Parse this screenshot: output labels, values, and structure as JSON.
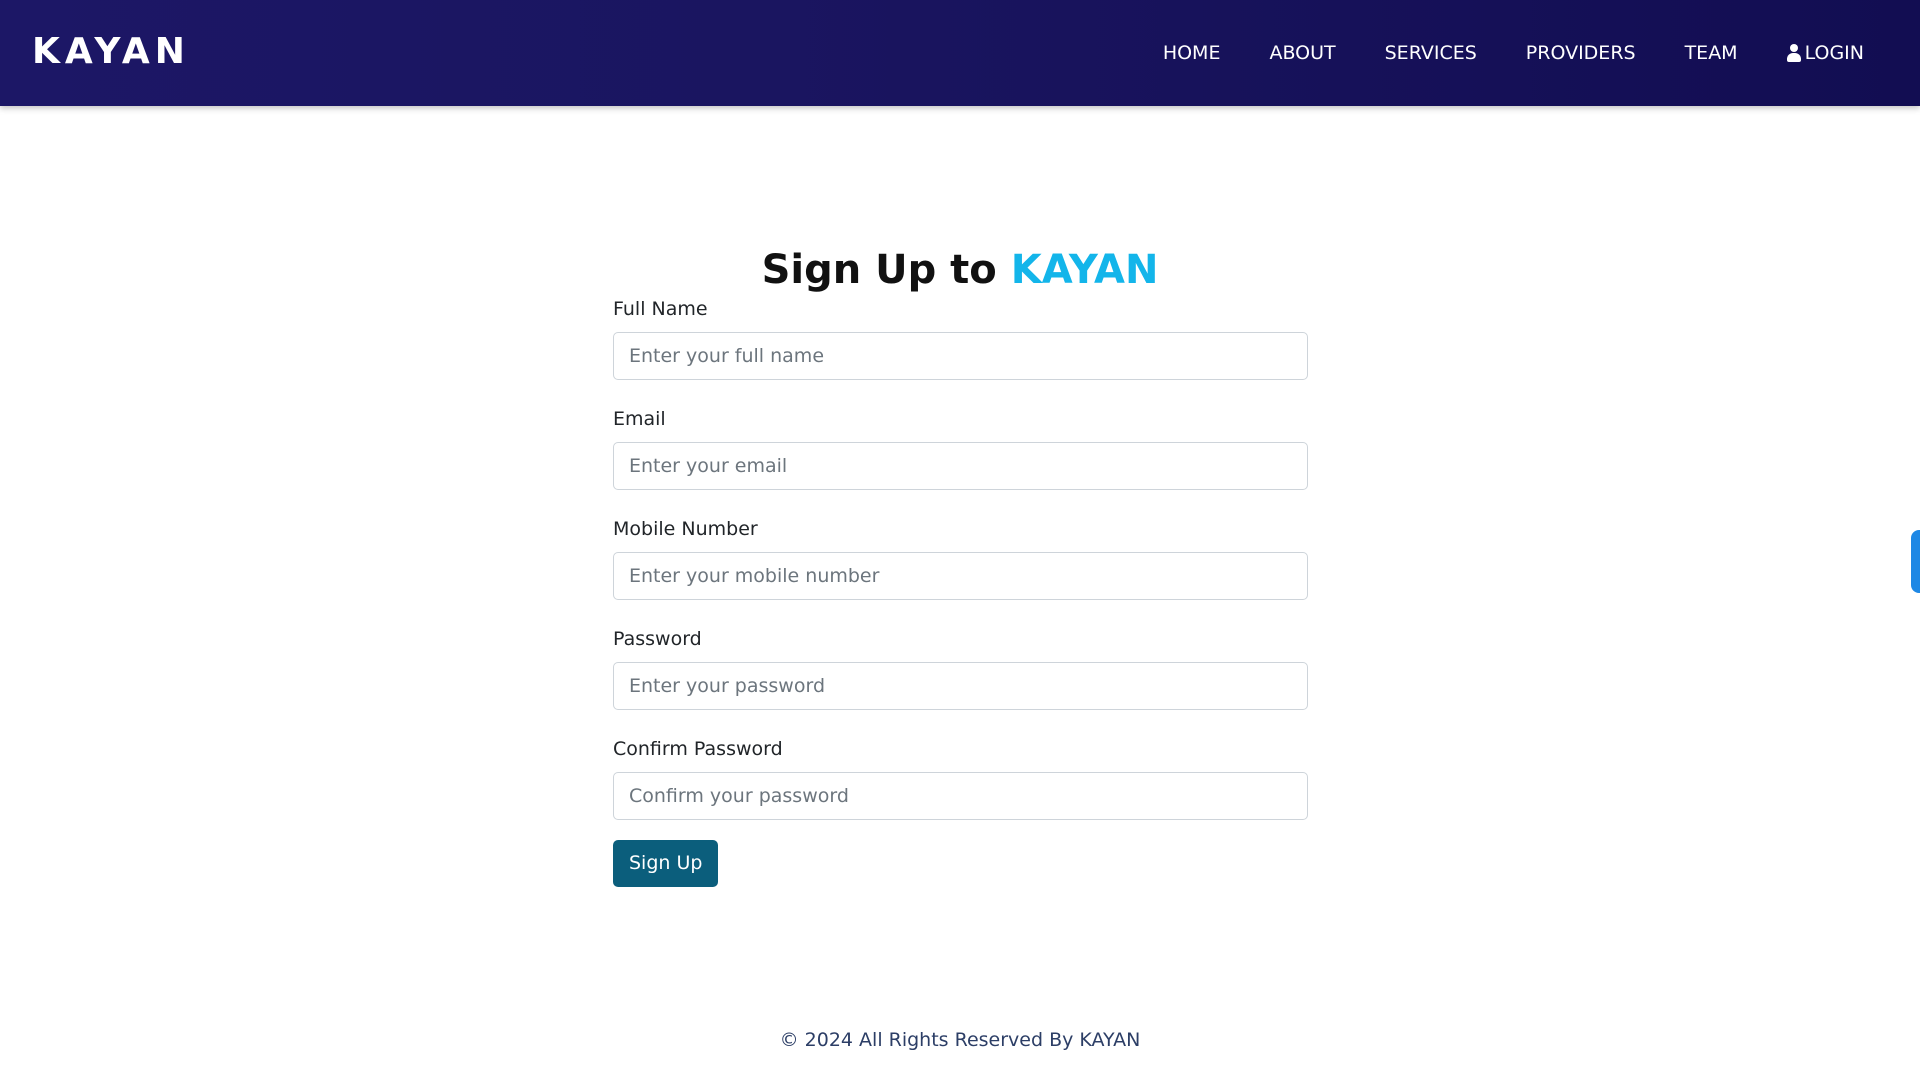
{
  "brand": "KAYAN",
  "nav": {
    "home": "HOME",
    "about": "ABOUT",
    "services": "SERVICES",
    "providers": "PROVIDERS",
    "team": "TEAM",
    "login": "LOGIN",
    "login_icon": "user-icon"
  },
  "page": {
    "title_prefix": "Sign Up to",
    "title_accent": "KAYAN",
    "accent_color": "#13b5ea"
  },
  "form": {
    "full_name": {
      "label": "Full Name",
      "placeholder": "Enter your full name",
      "value": ""
    },
    "email": {
      "label": "Email",
      "placeholder": "Enter your email",
      "value": ""
    },
    "mobile": {
      "label": "Mobile Number",
      "placeholder": "Enter your mobile number",
      "value": ""
    },
    "password": {
      "label": "Password",
      "placeholder": "Enter your password",
      "value": ""
    },
    "confirm_password": {
      "label": "Confirm Password",
      "placeholder": "Confirm your password",
      "value": ""
    },
    "submit_label": "Sign Up",
    "submit_color": "#0b5e7c"
  },
  "footer": {
    "text": "© 2024 All Rights Reserved By KAYAN"
  },
  "colors": {
    "navbar": "#1a1560",
    "side_tab": "#1e88e5"
  }
}
